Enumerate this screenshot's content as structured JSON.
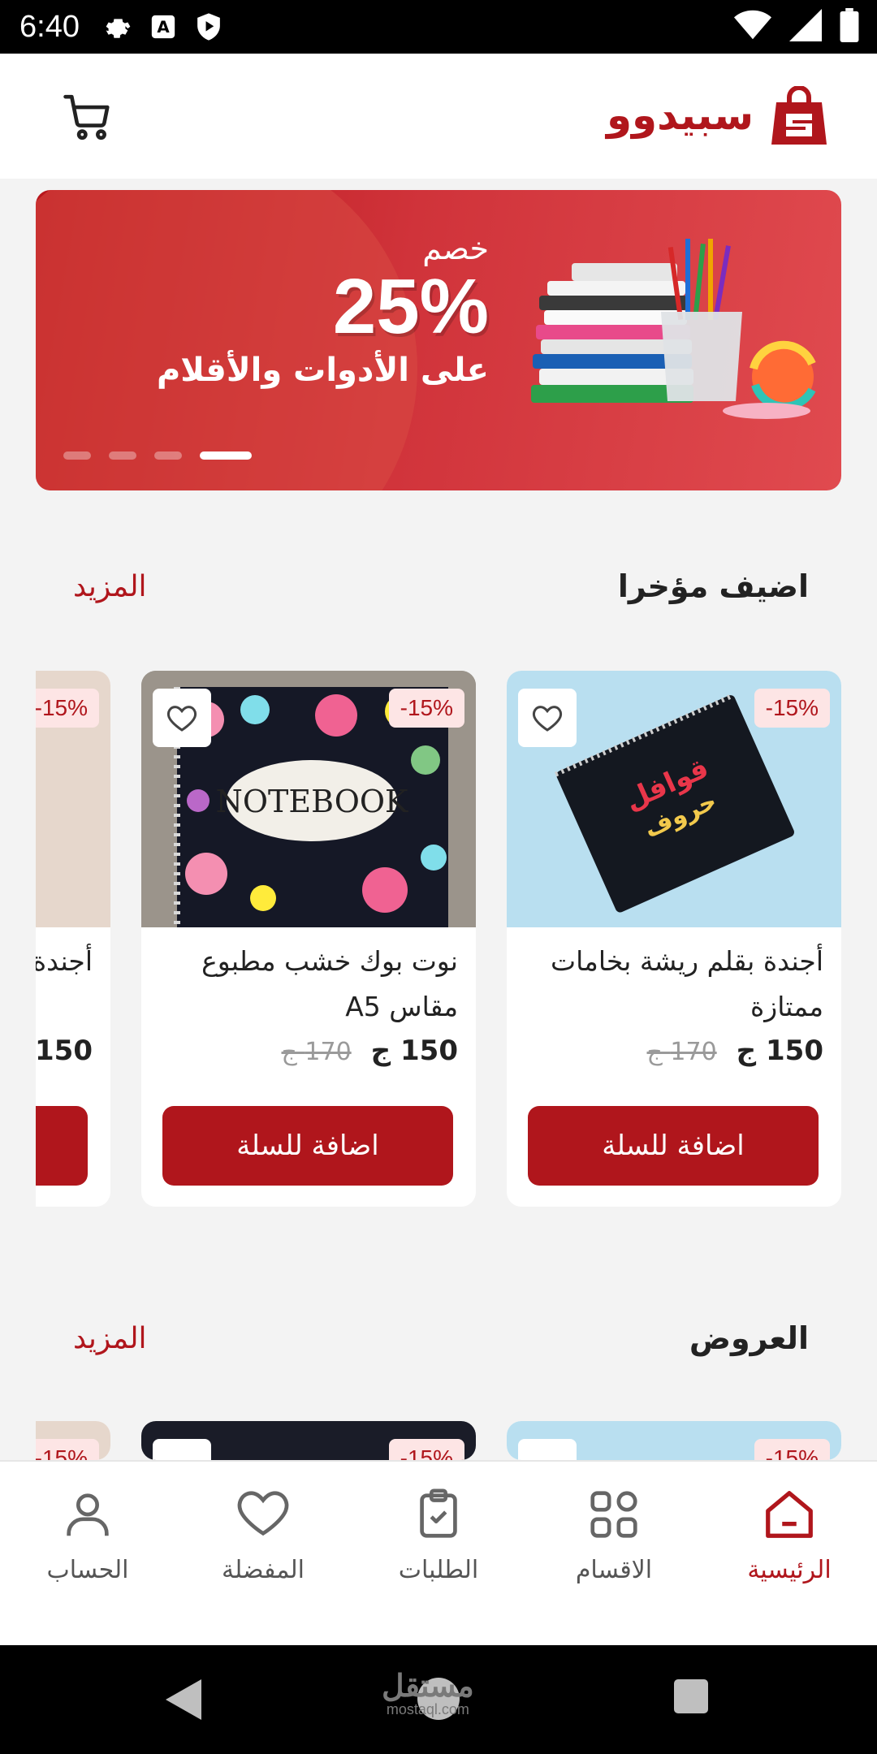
{
  "status_bar": {
    "time": "6:40"
  },
  "header": {
    "brand_name": "سبيدوو"
  },
  "banner": {
    "kicker": "خصم",
    "percent": "25%",
    "subtitle": "على الأدوات والأقلام",
    "dots": 4,
    "active_dot": 4
  },
  "sections": {
    "recent": {
      "title": "اضيف مؤخرا",
      "more": "المزيد"
    },
    "offers": {
      "title": "العروض",
      "more": "المزيد"
    }
  },
  "products": [
    {
      "title": "أجندة بقلم ريشة بخامات ممتازة",
      "price": "150 ج",
      "old_price": "170 ج",
      "discount": "-15%",
      "cta": "اضافة للسلة"
    },
    {
      "title": "نوت بوك خشب مطبوع مقاس A5",
      "price": "150 ج",
      "old_price": "170 ج",
      "discount": "-15%",
      "cta": "اضافة للسلة"
    },
    {
      "title": "أجندة ممتازة",
      "price": "150",
      "discount": "-15%"
    }
  ],
  "bottom_nav": [
    {
      "label": "الرئيسية",
      "icon": "home-icon",
      "active": true
    },
    {
      "label": "الاقسام",
      "icon": "grid-icon"
    },
    {
      "label": "الطلبات",
      "icon": "clipboard-icon"
    },
    {
      "label": "المفضلة",
      "icon": "heart-icon"
    },
    {
      "label": "الحساب",
      "icon": "user-icon"
    }
  ],
  "watermark": {
    "line1": "مستقل",
    "line2": "mostaql.com"
  },
  "colors": {
    "brand": "#b0161c",
    "banner": "#c8262c",
    "card_light": "#b9dff0",
    "card_dark": "#151826"
  }
}
